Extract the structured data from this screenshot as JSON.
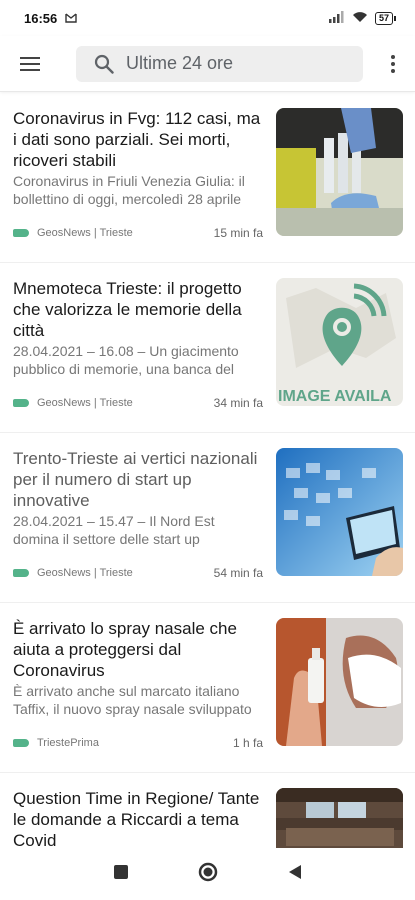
{
  "status_bar": {
    "time": "16:56",
    "battery": "57"
  },
  "app_bar": {
    "search_text": "Ultime 24 ore"
  },
  "articles": [
    {
      "title": "Coronavirus in Fvg: 112 casi, ma i dati sono parziali. Sei morti, ricoveri stabili",
      "snippet_lines": [
        "Coronavirus in Friuli Venezia Giulia: il",
        "bollettino di oggi, mercoledì 28 aprile"
      ],
      "source": "GeosNews | Trieste",
      "time": "15 min fa"
    },
    {
      "title": "Mnemoteca Trieste: il progetto che valorizza le memorie della città",
      "snippet_lines": [
        "28.04.2021 – 16.08 – Un giacimento",
        "pubblico di memorie, una banca del"
      ],
      "source": "GeosNews | Trieste",
      "time": "34 min fa",
      "image_caption": "IMAGE AVAILA"
    },
    {
      "title": "Trento-Trieste ai vertici nazionali per il numero di start up innovative",
      "snippet_lines": [
        "28.04.2021 – 15.47 – Il Nord Est",
        "domina il settore delle start up"
      ],
      "source": "GeosNews | Trieste",
      "time": "54 min fa"
    },
    {
      "title": "È arrivato lo spray nasale che aiuta a proteggersi dal Coronavirus",
      "snippet_lines": [
        "È arrivato anche sul marcato italiano",
        "Taffix, il nuovo spray nasale sviluppato"
      ],
      "source": "TriestePrima",
      "time": "1 h fa"
    },
    {
      "title": "Question Time in Regione/ Tante le domande a Riccardi a tema Covid",
      "snippet_lines": [],
      "source": "",
      "time": ""
    }
  ]
}
